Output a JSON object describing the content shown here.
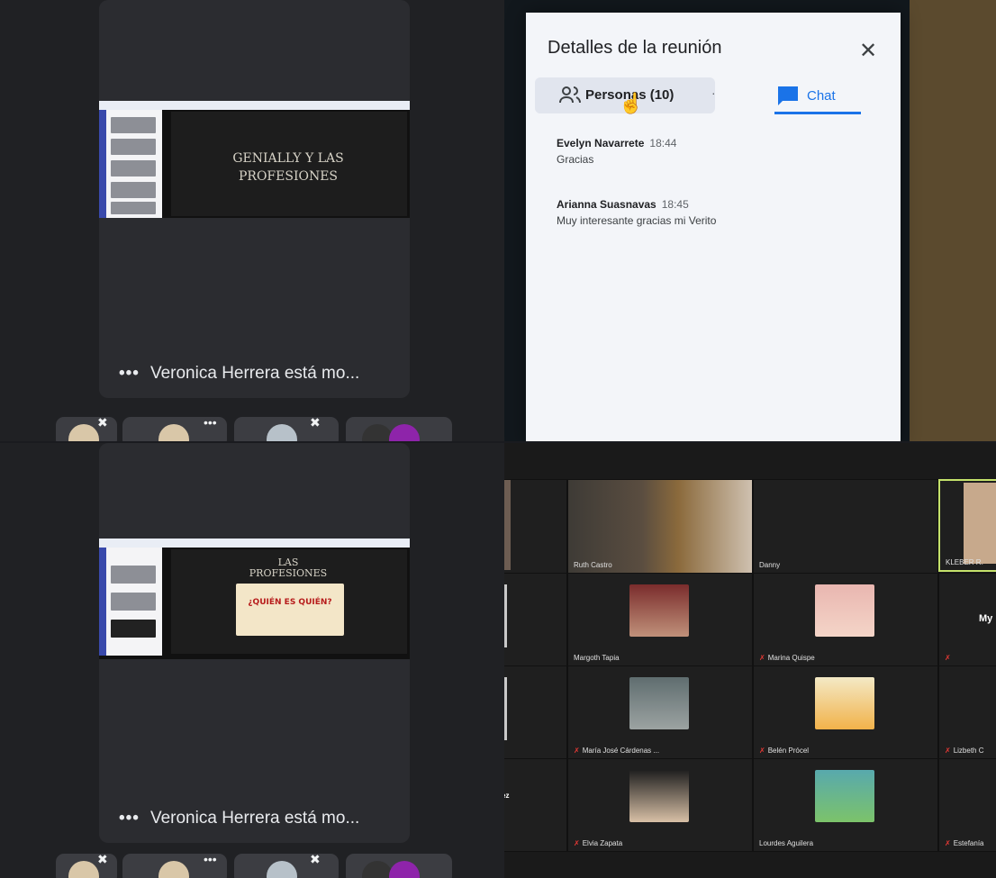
{
  "meet_panels": [
    {
      "share_text": "Veronica Herrera está mo...",
      "slide_lines": [
        "GENIALLY Y LAS",
        "PROFESIONES"
      ]
    },
    {
      "share_text": "Veronica Herrera está mo...",
      "slide_lines": [
        "LAS",
        "PROFESIONES",
        "¿QUIÉN ES QUIÉN?"
      ]
    }
  ],
  "meeting_details": {
    "title": "Detalles de la reunión",
    "close": "✕",
    "tab_people": "Personas (10)",
    "tab_chat": "Chat",
    "messages": [
      {
        "sender": "Evelyn Navarrete",
        "time": "18:44",
        "text": "Gracias"
      },
      {
        "sender": "Arianna Suasnavas",
        "time": "18:45",
        "text": "Muy interesante gracias mi Verito"
      }
    ]
  },
  "zoom_grid": {
    "rows": [
      [
        {
          "name": "Ruth Castro",
          "muted": false
        },
        {
          "name": "Danny",
          "muted": false
        },
        {
          "name": "KLEBER R.",
          "muted": false
        }
      ],
      [
        {
          "name": "Margoth Tapia",
          "muted": false
        },
        {
          "name": "Marina Quispe",
          "muted": true
        },
        {
          "name": "",
          "muted": true
        }
      ],
      [
        {
          "name": "María José Cárdenas ...",
          "muted": true
        },
        {
          "name": "Belén Prócel",
          "muted": true
        },
        {
          "name": "Lizbeth C",
          "muted": true
        }
      ],
      [
        {
          "name": "Elvia Zapata",
          "muted": true
        },
        {
          "name": "Lourdes Aguilera",
          "muted": false
        },
        {
          "name": "Estefanía",
          "muted": true
        }
      ]
    ],
    "partial_text": {
      "my": "My",
      "ez": "ez"
    }
  },
  "colors": {
    "meet_bg": "#202124",
    "accent": "#1a73e8",
    "zoom_bg": "#1a1a1a",
    "muted_mic": "#e53935"
  }
}
